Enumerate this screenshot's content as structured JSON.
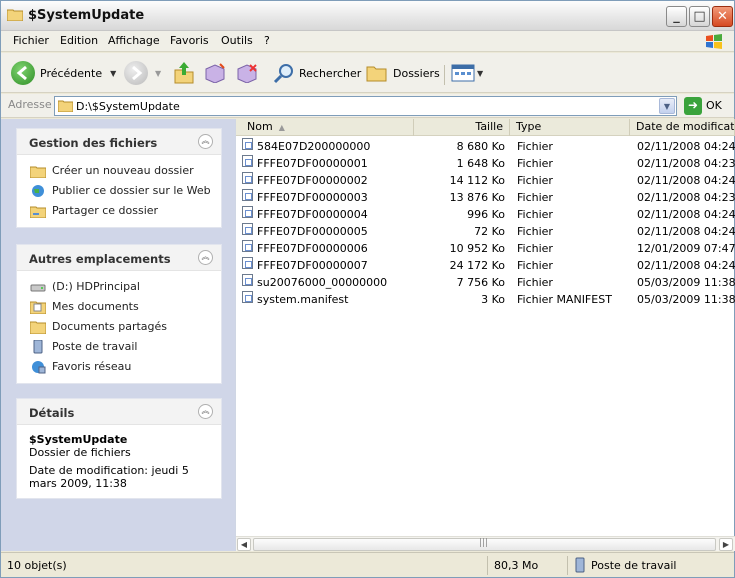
{
  "window": {
    "title": "$SystemUpdate"
  },
  "menu": [
    "Fichier",
    "Edition",
    "Affichage",
    "Favoris",
    "Outils",
    "?"
  ],
  "toolbar": {
    "back": "Précédente",
    "search": "Rechercher",
    "folders": "Dossiers"
  },
  "address": {
    "label": "Adresse",
    "value": "D:\\$SystemUpdate",
    "go": "OK"
  },
  "tasks": {
    "title": "Gestion des fichiers",
    "items": [
      "Créer un nouveau dossier",
      "Publier ce dossier sur le Web",
      "Partager ce dossier"
    ]
  },
  "places": {
    "title": "Autres emplacements",
    "items": [
      "(D:) HDPrincipal",
      "Mes documents",
      "Documents partagés",
      "Poste de travail",
      "Favoris réseau"
    ]
  },
  "details": {
    "title": "Détails",
    "name": "$SystemUpdate",
    "type": "Dossier de fichiers",
    "modified": "Date de modification: jeudi 5 mars 2009, 11:38"
  },
  "columns": [
    "Nom",
    "Taille",
    "Type",
    "Date de modification"
  ],
  "files": [
    {
      "name": "584E07D200000000",
      "size": "8 680 Ko",
      "type": "Fichier",
      "date": "02/11/2008 04:24"
    },
    {
      "name": "FFFE07DF00000001",
      "size": "1 648 Ko",
      "type": "Fichier",
      "date": "02/11/2008 04:23"
    },
    {
      "name": "FFFE07DF00000002",
      "size": "14 112 Ko",
      "type": "Fichier",
      "date": "02/11/2008 04:24"
    },
    {
      "name": "FFFE07DF00000003",
      "size": "13 876 Ko",
      "type": "Fichier",
      "date": "02/11/2008 04:23"
    },
    {
      "name": "FFFE07DF00000004",
      "size": "996 Ko",
      "type": "Fichier",
      "date": "02/11/2008 04:24"
    },
    {
      "name": "FFFE07DF00000005",
      "size": "72 Ko",
      "type": "Fichier",
      "date": "02/11/2008 04:24"
    },
    {
      "name": "FFFE07DF00000006",
      "size": "10 952 Ko",
      "type": "Fichier",
      "date": "12/01/2009 07:47"
    },
    {
      "name": "FFFE07DF00000007",
      "size": "24 172 Ko",
      "type": "Fichier",
      "date": "02/11/2008 04:24"
    },
    {
      "name": "su20076000_00000000",
      "size": "7 756 Ko",
      "type": "Fichier",
      "date": "05/03/2009 11:38"
    },
    {
      "name": "system.manifest",
      "size": "3 Ko",
      "type": "Fichier MANIFEST",
      "date": "05/03/2009 11:38"
    }
  ],
  "status": {
    "count": "10 objet(s)",
    "size": "80,3 Mo",
    "location": "Poste de travail"
  }
}
